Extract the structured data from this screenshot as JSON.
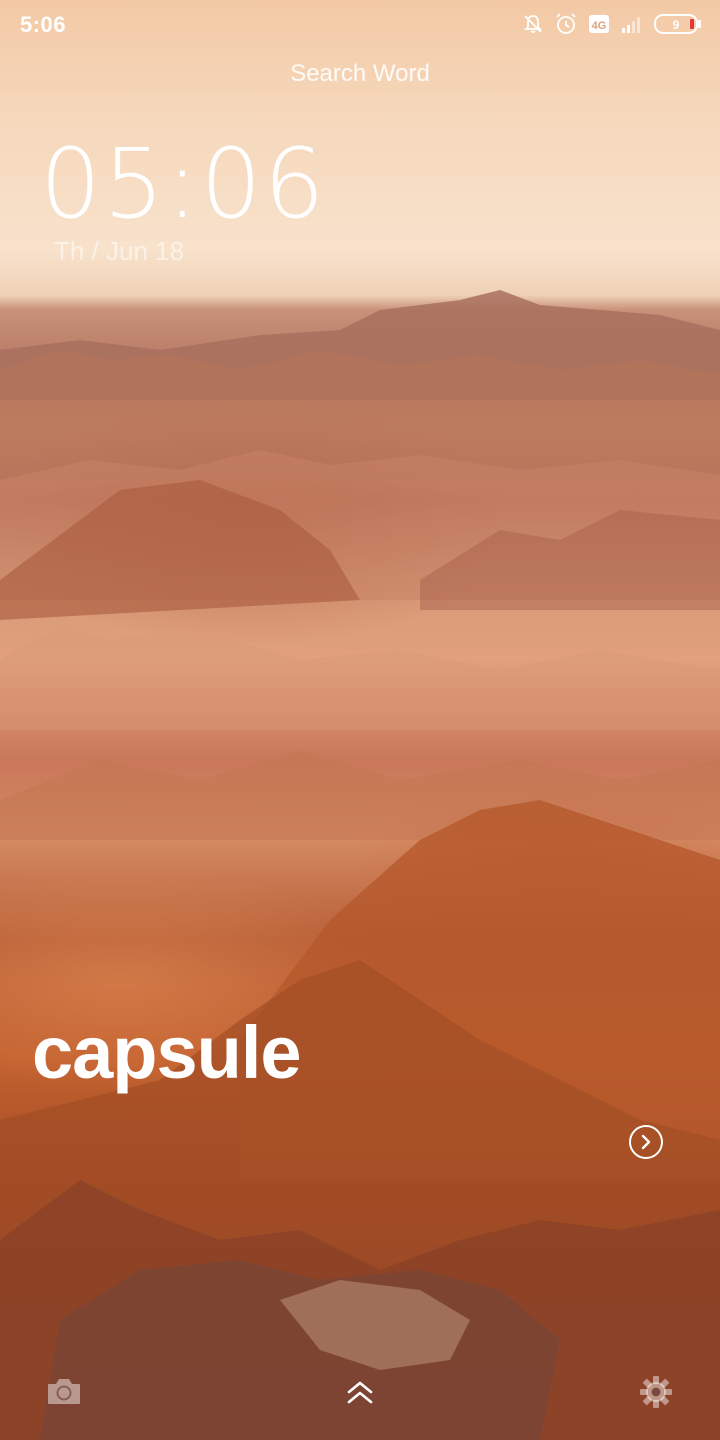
{
  "status_bar": {
    "time": "5:06",
    "icons": [
      "muted-bell-icon",
      "alarm-icon",
      "data-badge-icon",
      "signal-icon",
      "battery-icon"
    ],
    "battery_level": "9"
  },
  "search": {
    "label": "Search Word"
  },
  "clock": {
    "time": "05:06",
    "date": "Th / Jun 18"
  },
  "caption": {
    "text": "capsule"
  },
  "bottom_bar": {
    "icons": [
      "camera-icon",
      "swipe-up-icon",
      "settings-icon"
    ]
  },
  "colors": {
    "sky": "#f6d8bc",
    "terrain": "#c2612f",
    "text": "#ffffff",
    "battery_low": "#e53935"
  }
}
